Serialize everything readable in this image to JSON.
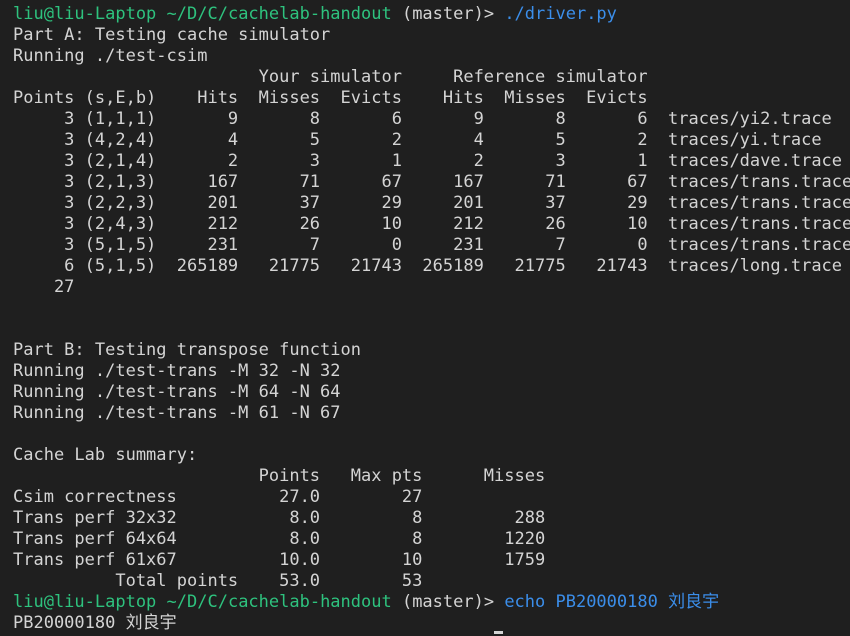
{
  "prompt1": {
    "user_host": "liu@liu-Laptop",
    "path": "~/D/C/cachelab-handout",
    "branch": " (master)> ",
    "command": "./driver.py"
  },
  "lines_a": [
    "Part A: Testing cache simulator",
    "Running ./test-csim",
    "                        Your simulator     Reference simulator",
    "Points (s,E,b)    Hits  Misses  Evicts    Hits  Misses  Evicts",
    "     3 (1,1,1)       9       8       6       9       8       6  traces/yi2.trace",
    "     3 (4,2,4)       4       5       2       4       5       2  traces/yi.trace",
    "     3 (2,1,4)       2       3       1       2       3       1  traces/dave.trace",
    "     3 (2,1,3)     167      71      67     167      71      67  traces/trans.trace",
    "     3 (2,2,3)     201      37      29     201      37      29  traces/trans.trace",
    "     3 (2,4,3)     212      26      10     212      26      10  traces/trans.trace",
    "     3 (5,1,5)     231       7       0     231       7       0  traces/trans.trace",
    "     6 (5,1,5)  265189   21775   21743  265189   21775   21743  traces/long.trace",
    "    27",
    "",
    "",
    "Part B: Testing transpose function",
    "Running ./test-trans -M 32 -N 32",
    "Running ./test-trans -M 64 -N 64",
    "Running ./test-trans -M 61 -N 67",
    "",
    "Cache Lab summary:",
    "                        Points   Max pts      Misses",
    "Csim correctness          27.0        27",
    "Trans perf 32x32           8.0         8         288",
    "Trans perf 64x64           8.0         8        1220",
    "Trans perf 61x67          10.0        10        1759",
    "          Total points    53.0        53"
  ],
  "prompt2": {
    "user_host": "liu@liu-Laptop",
    "path": "~/D/C/cachelab-handout",
    "branch": " (master)> ",
    "command": "echo PB20000180 刘良宇"
  },
  "output_last": "PB20000180 刘良宇"
}
